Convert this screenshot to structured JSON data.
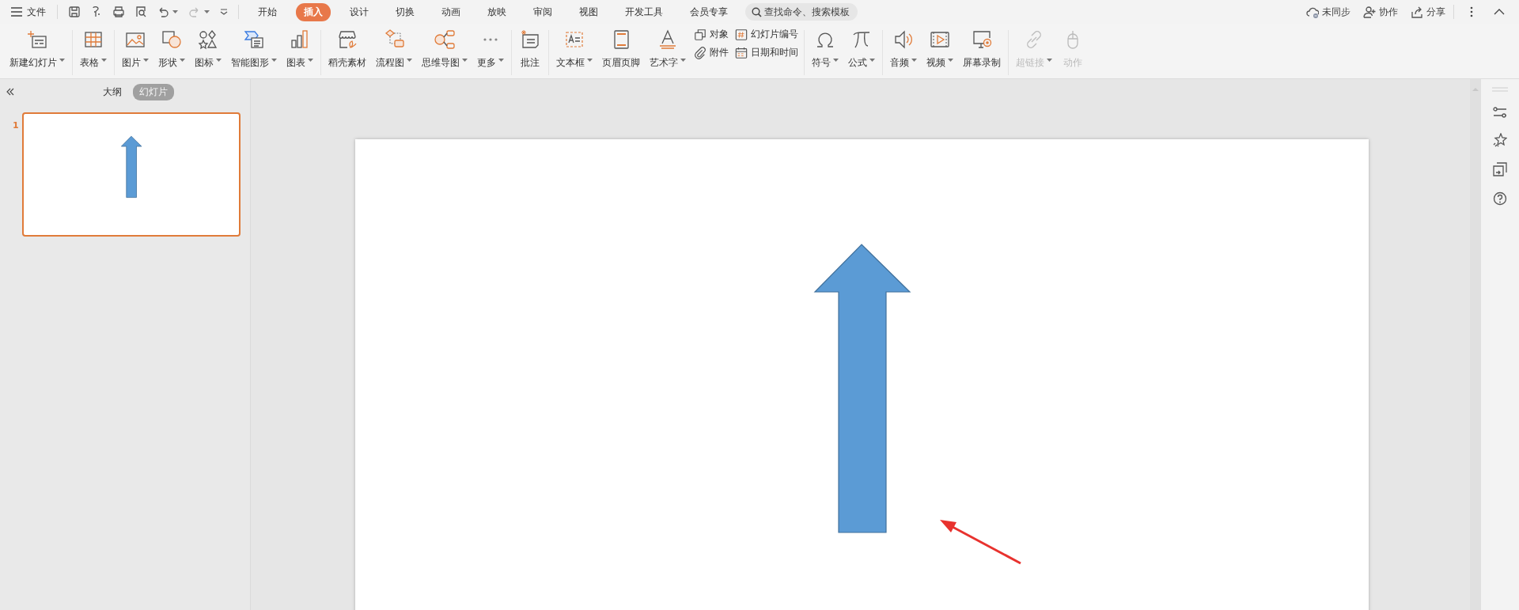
{
  "menu": {
    "label": "文件"
  },
  "tabs": [
    {
      "label": "开始",
      "selected": false
    },
    {
      "label": "插入",
      "selected": true
    },
    {
      "label": "设计",
      "selected": false
    },
    {
      "label": "切换",
      "selected": false
    },
    {
      "label": "动画",
      "selected": false
    },
    {
      "label": "放映",
      "selected": false
    },
    {
      "label": "审阅",
      "selected": false
    },
    {
      "label": "视图",
      "selected": false
    },
    {
      "label": "开发工具",
      "selected": false
    },
    {
      "label": "会员专享",
      "selected": false
    }
  ],
  "search": {
    "placeholder": "查找命令、搜索模板"
  },
  "top_actions": [
    {
      "label": "未同步"
    },
    {
      "label": "协作"
    },
    {
      "label": "分享"
    }
  ],
  "ribbon": {
    "groups": [
      [
        {
          "kind": "large",
          "label": "新建幻灯片",
          "dropdown": true,
          "disabled": false
        }
      ],
      [
        {
          "kind": "large",
          "label": "表格",
          "dropdown": true,
          "disabled": false
        }
      ],
      [
        {
          "kind": "large",
          "label": "图片",
          "dropdown": true,
          "disabled": false
        },
        {
          "kind": "large",
          "label": "形状",
          "dropdown": true,
          "disabled": false
        },
        {
          "kind": "large",
          "label": "图标",
          "dropdown": true,
          "disabled": false
        },
        {
          "kind": "large",
          "label": "智能图形",
          "dropdown": true,
          "disabled": false
        },
        {
          "kind": "large",
          "label": "图表",
          "dropdown": true,
          "disabled": false
        }
      ],
      [
        {
          "kind": "large",
          "label": "稻壳素材",
          "dropdown": false,
          "disabled": false
        },
        {
          "kind": "large",
          "label": "流程图",
          "dropdown": true,
          "disabled": false
        },
        {
          "kind": "large",
          "label": "思维导图",
          "dropdown": true,
          "disabled": false
        },
        {
          "kind": "large",
          "label": "更多",
          "dropdown": true,
          "disabled": false
        }
      ],
      [
        {
          "kind": "large",
          "label": "批注",
          "dropdown": false,
          "disabled": false
        }
      ],
      [
        {
          "kind": "large",
          "label": "文本框",
          "dropdown": true,
          "disabled": false
        },
        {
          "kind": "large",
          "label": "页眉页脚",
          "dropdown": false,
          "disabled": false
        },
        {
          "kind": "large",
          "label": "艺术字",
          "dropdown": true,
          "disabled": false
        },
        {
          "kind": "stack",
          "items": [
            {
              "label": "对象",
              "disabled": false
            },
            {
              "label": "附件",
              "disabled": false
            }
          ]
        },
        {
          "kind": "stack",
          "items": [
            {
              "label": "幻灯片编号",
              "disabled": false
            },
            {
              "label": "日期和时间",
              "disabled": false
            }
          ]
        }
      ],
      [
        {
          "kind": "large",
          "label": "符号",
          "dropdown": true,
          "disabled": false
        },
        {
          "kind": "large",
          "label": "公式",
          "dropdown": true,
          "disabled": false
        }
      ],
      [
        {
          "kind": "large",
          "label": "音频",
          "dropdown": true,
          "disabled": false
        },
        {
          "kind": "large",
          "label": "视频",
          "dropdown": true,
          "disabled": false
        },
        {
          "kind": "large",
          "label": "屏幕录制",
          "dropdown": false,
          "disabled": false
        }
      ],
      [
        {
          "kind": "large",
          "label": "超链接",
          "dropdown": true,
          "disabled": true
        },
        {
          "kind": "large",
          "label": "动作",
          "dropdown": false,
          "disabled": true
        }
      ]
    ]
  },
  "panel": {
    "tabs": [
      {
        "label": "大纲",
        "selected": false
      },
      {
        "label": "幻灯片",
        "selected": true
      }
    ],
    "slides": [
      {
        "number": "1",
        "selected": true
      }
    ]
  }
}
